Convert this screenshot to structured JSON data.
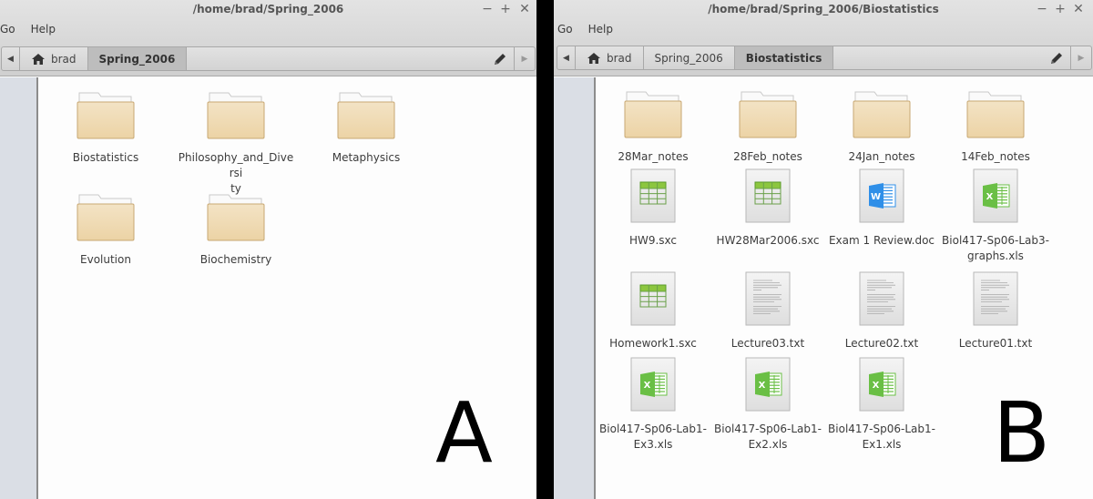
{
  "panel_a": {
    "title": "/home/brad/Spring_2006",
    "menu": [
      "Go",
      "Help"
    ],
    "window_controls": {
      "minimize": "−",
      "maximize": "+",
      "close": "✕"
    },
    "pathbar": {
      "back_icon": "◀",
      "home_label": "brad",
      "crumbs": [
        "Spring_2006"
      ],
      "active_index": 0,
      "edit_icon": "pencil-icon",
      "forward_icon": "▶"
    },
    "items": [
      {
        "name": "Biostatistics",
        "type": "folder"
      },
      {
        "name": "Philosophy_and_Diversity",
        "label_lines": [
          "Philosophy_and_Diversi",
          "ty"
        ],
        "type": "folder"
      },
      {
        "name": "Metaphysics",
        "type": "folder"
      },
      {
        "name": "Evolution",
        "type": "folder"
      },
      {
        "name": "Biochemistry",
        "type": "folder"
      }
    ],
    "panel_letter": "A"
  },
  "panel_b": {
    "title": "/home/brad/Spring_2006/Biostatistics",
    "menu": [
      "Go",
      "Help"
    ],
    "window_controls": {
      "minimize": "−",
      "maximize": "+",
      "close": "✕"
    },
    "pathbar": {
      "back_icon": "◀",
      "home_label": "brad",
      "crumbs": [
        "Spring_2006",
        "Biostatistics"
      ],
      "active_index": 1,
      "edit_icon": "pencil-icon",
      "forward_icon": "▶"
    },
    "items": [
      {
        "name": "28Mar_notes",
        "type": "folder"
      },
      {
        "name": "28Feb_notes",
        "type": "folder"
      },
      {
        "name": "24Jan_notes",
        "type": "folder"
      },
      {
        "name": "14Feb_notes",
        "type": "folder"
      },
      {
        "name": "HW9.sxc",
        "type": "spreadsheet"
      },
      {
        "name": "HW28Mar2006.sxc",
        "type": "spreadsheet"
      },
      {
        "name": "Exam 1 Review.doc",
        "type": "word"
      },
      {
        "name": "Biol417-Sp06-Lab3-graphs.xls",
        "label_lines": [
          "Biol417-Sp06-Lab3-",
          "graphs.xls"
        ],
        "type": "excel"
      },
      {
        "name": "Homework1.sxc",
        "type": "spreadsheet"
      },
      {
        "name": "Lecture03.txt",
        "type": "text"
      },
      {
        "name": "Lecture02.txt",
        "type": "text"
      },
      {
        "name": "Lecture01.txt",
        "type": "text"
      },
      {
        "name": "Biol417-Sp06-Lab1-Ex3.xls",
        "label_lines": [
          "Biol417-Sp06-Lab1-",
          "Ex3.xls"
        ],
        "type": "excel"
      },
      {
        "name": "Biol417-Sp06-Lab1-Ex2.xls",
        "label_lines": [
          "Biol417-Sp06-Lab1-",
          "Ex2.xls"
        ],
        "type": "excel"
      },
      {
        "name": "Biol417-Sp06-Lab1-Ex1.xls",
        "label_lines": [
          "Biol417-Sp06-Lab1-",
          "Ex1.xls"
        ],
        "type": "excel"
      }
    ],
    "panel_letter": "B"
  },
  "colors": {
    "folder_body": "#ecd3a5",
    "sheet_green": "#8cc63f",
    "word_blue": "#2f8fe8",
    "excel_green": "#6abf45",
    "sidebar": "#dadee5",
    "divider": "#000000"
  }
}
